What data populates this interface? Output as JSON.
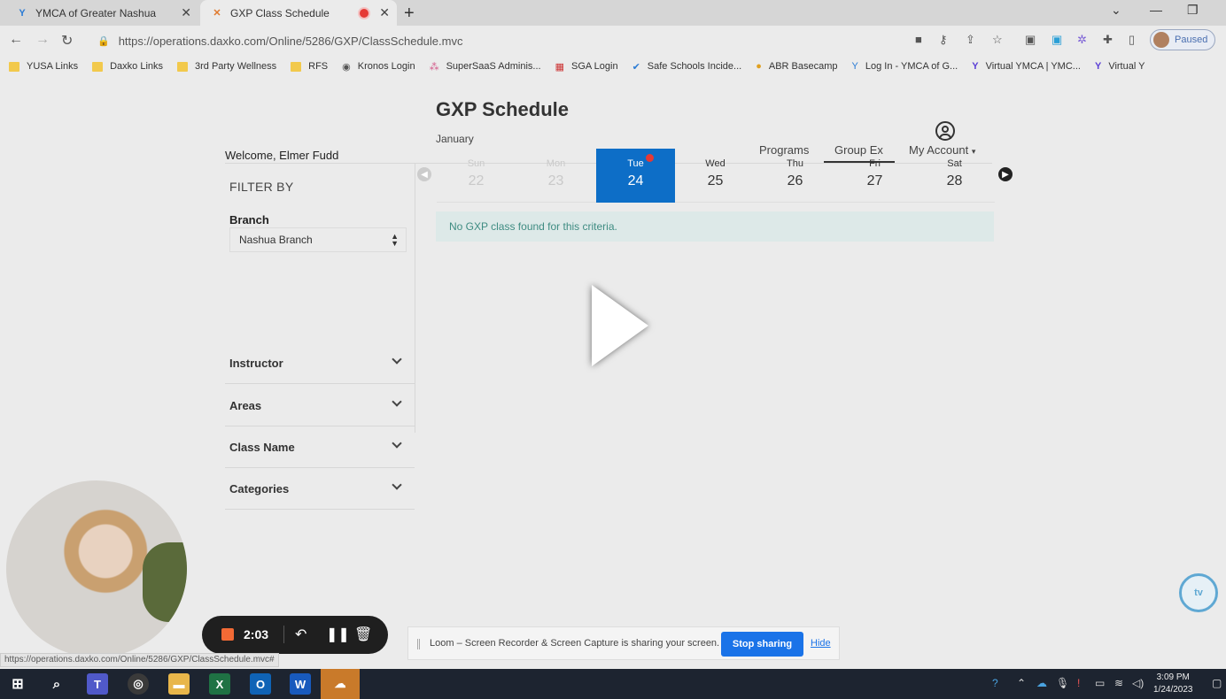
{
  "browser": {
    "tabs": [
      {
        "title": "YMCA of Greater Nashua",
        "favicon": "ymca-icon"
      },
      {
        "title": "GXP Class Schedule",
        "favicon": "daxko-icon",
        "active": true,
        "recording": true
      }
    ],
    "url": "https://operations.daxko.com/Online/5286/GXP/ClassSchedule.mvc",
    "profile_label": "Paused",
    "bookmarks": [
      "YUSA Links",
      "Daxko Links",
      "3rd Party Wellness",
      "RFS",
      "Kronos Login",
      "SuperSaaS Adminis...",
      "SGA Login",
      "Safe Schools Incide...",
      "ABR Basecamp",
      "Log In - YMCA of G...",
      "Virtual YMCA | YMC...",
      "Virtual Y"
    ]
  },
  "page": {
    "welcome": "Welcome, Elmer Fudd",
    "nav": {
      "programs": "Programs",
      "groupex": "Group Ex",
      "account": "My Account"
    },
    "filter": {
      "heading": "FILTER BY",
      "branch_label": "Branch",
      "branch_value": "Nashua Branch",
      "sections": [
        "Instructor",
        "Areas",
        "Class Name",
        "Categories"
      ]
    },
    "schedule": {
      "title": "GXP Schedule",
      "month": "January",
      "days": [
        {
          "name": "Sun",
          "num": "22",
          "state": "past"
        },
        {
          "name": "Mon",
          "num": "23",
          "state": "past"
        },
        {
          "name": "Tue",
          "num": "24",
          "state": "selected"
        },
        {
          "name": "Wed",
          "num": "25",
          "state": "normal"
        },
        {
          "name": "Thu",
          "num": "26",
          "state": "normal"
        },
        {
          "name": "Fri",
          "num": "27",
          "state": "normal"
        },
        {
          "name": "Sat",
          "num": "28",
          "state": "normal"
        }
      ],
      "empty_message": "No GXP class found for this criteria.",
      "accent_color": "#0d6ec7"
    }
  },
  "recorder": {
    "elapsed": "2:03",
    "share_message": "Loom – Screen Recorder & Screen Capture is sharing your screen.",
    "stop_label": "Stop sharing",
    "hide_label": "Hide"
  },
  "status_url": "https://operations.daxko.com/Online/5286/GXP/ClassSchedule.mvc#",
  "taskbar": {
    "time": "3:09 PM",
    "date": "1/24/2023"
  }
}
